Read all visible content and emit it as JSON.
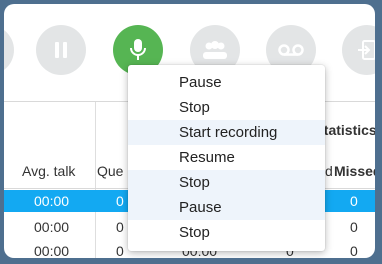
{
  "toolbar": {
    "buttons": [
      {
        "name": "pause-button",
        "icon": "pause-icon"
      },
      {
        "name": "record-button",
        "icon": "microphone-icon",
        "color": "#56b553"
      },
      {
        "name": "conference-button",
        "icon": "group-icon"
      },
      {
        "name": "voicemail-button",
        "icon": "voicemail-icon"
      },
      {
        "name": "transfer-button",
        "icon": "transfer-icon"
      }
    ]
  },
  "table": {
    "group_header": "statistics",
    "headers": [
      "Avg. talk",
      "Que",
      "d",
      "Missed"
    ],
    "rows": [
      {
        "avg_talk": "00:00",
        "queue": "0",
        "missed": "0",
        "selected": true
      },
      {
        "avg_talk": "00:00",
        "queue": "0",
        "missed": "0",
        "selected": false
      },
      {
        "avg_talk": "00:00",
        "queue": "0",
        "col3": "00:00",
        "col4": "0",
        "missed": "0",
        "selected": false
      }
    ]
  },
  "menu": {
    "items": [
      "Pause",
      "Stop",
      "Start recording",
      "Resume",
      "Stop",
      "Pause",
      "Stop"
    ]
  },
  "colors": {
    "accent": "#13a9f2",
    "record": "#56b553",
    "frame": "#4e6f8f"
  }
}
